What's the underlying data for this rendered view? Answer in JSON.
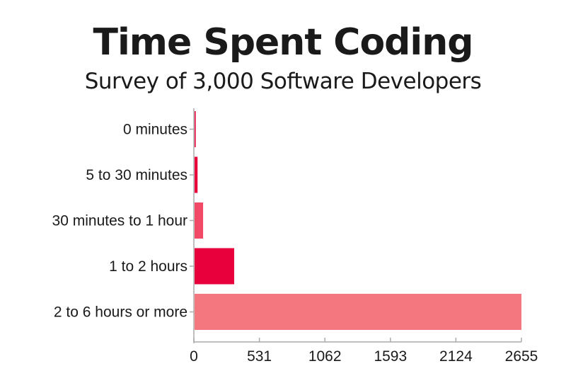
{
  "chart_data": {
    "type": "bar",
    "orientation": "horizontal",
    "title": "Time Spent Coding",
    "subtitle": "Survey of 3,000 Software Developers",
    "categories": [
      "0 minutes",
      "5 to 30 minutes",
      "30 minutes to 1 hour",
      "1 to 2 hours",
      "2 to 6 hours or more"
    ],
    "values": [
      15,
      30,
      75,
      327,
      2655
    ],
    "colors": [
      "#e8003d",
      "#e8003d",
      "#f24a66",
      "#e8003d",
      "#f4777f"
    ],
    "xlabel": "",
    "ylabel": "",
    "xlim": [
      0,
      2655
    ],
    "xticks": [
      0,
      531,
      1062,
      1593,
      2124,
      2655
    ],
    "xtick_labels": [
      "0",
      "531",
      "1062",
      "1593",
      "2124",
      "2655"
    ],
    "grid": false,
    "legend": "none",
    "axis_color": "#aaaaaa"
  }
}
